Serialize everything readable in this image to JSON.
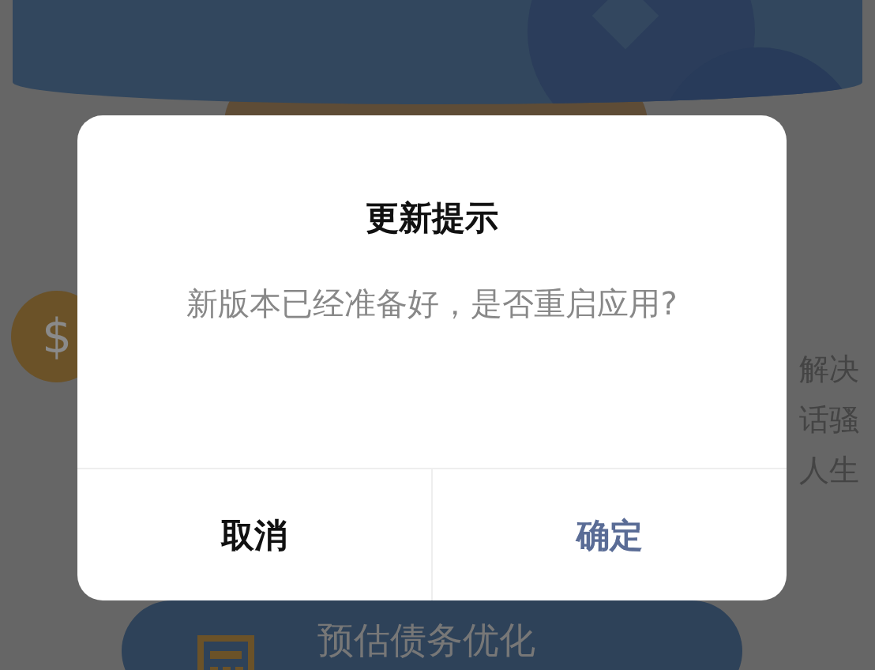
{
  "background": {
    "coin_symbol": "$",
    "side_text": [
      "解决",
      "话骚",
      "人生"
    ],
    "estimate_button": "预估债务优化"
  },
  "dialog": {
    "title": "更新提示",
    "message": "新版本已经准备好，是否重启应用?",
    "buttons": [
      {
        "label": "取消",
        "kind": "cancel"
      },
      {
        "label": "确定",
        "kind": "confirm"
      }
    ]
  }
}
